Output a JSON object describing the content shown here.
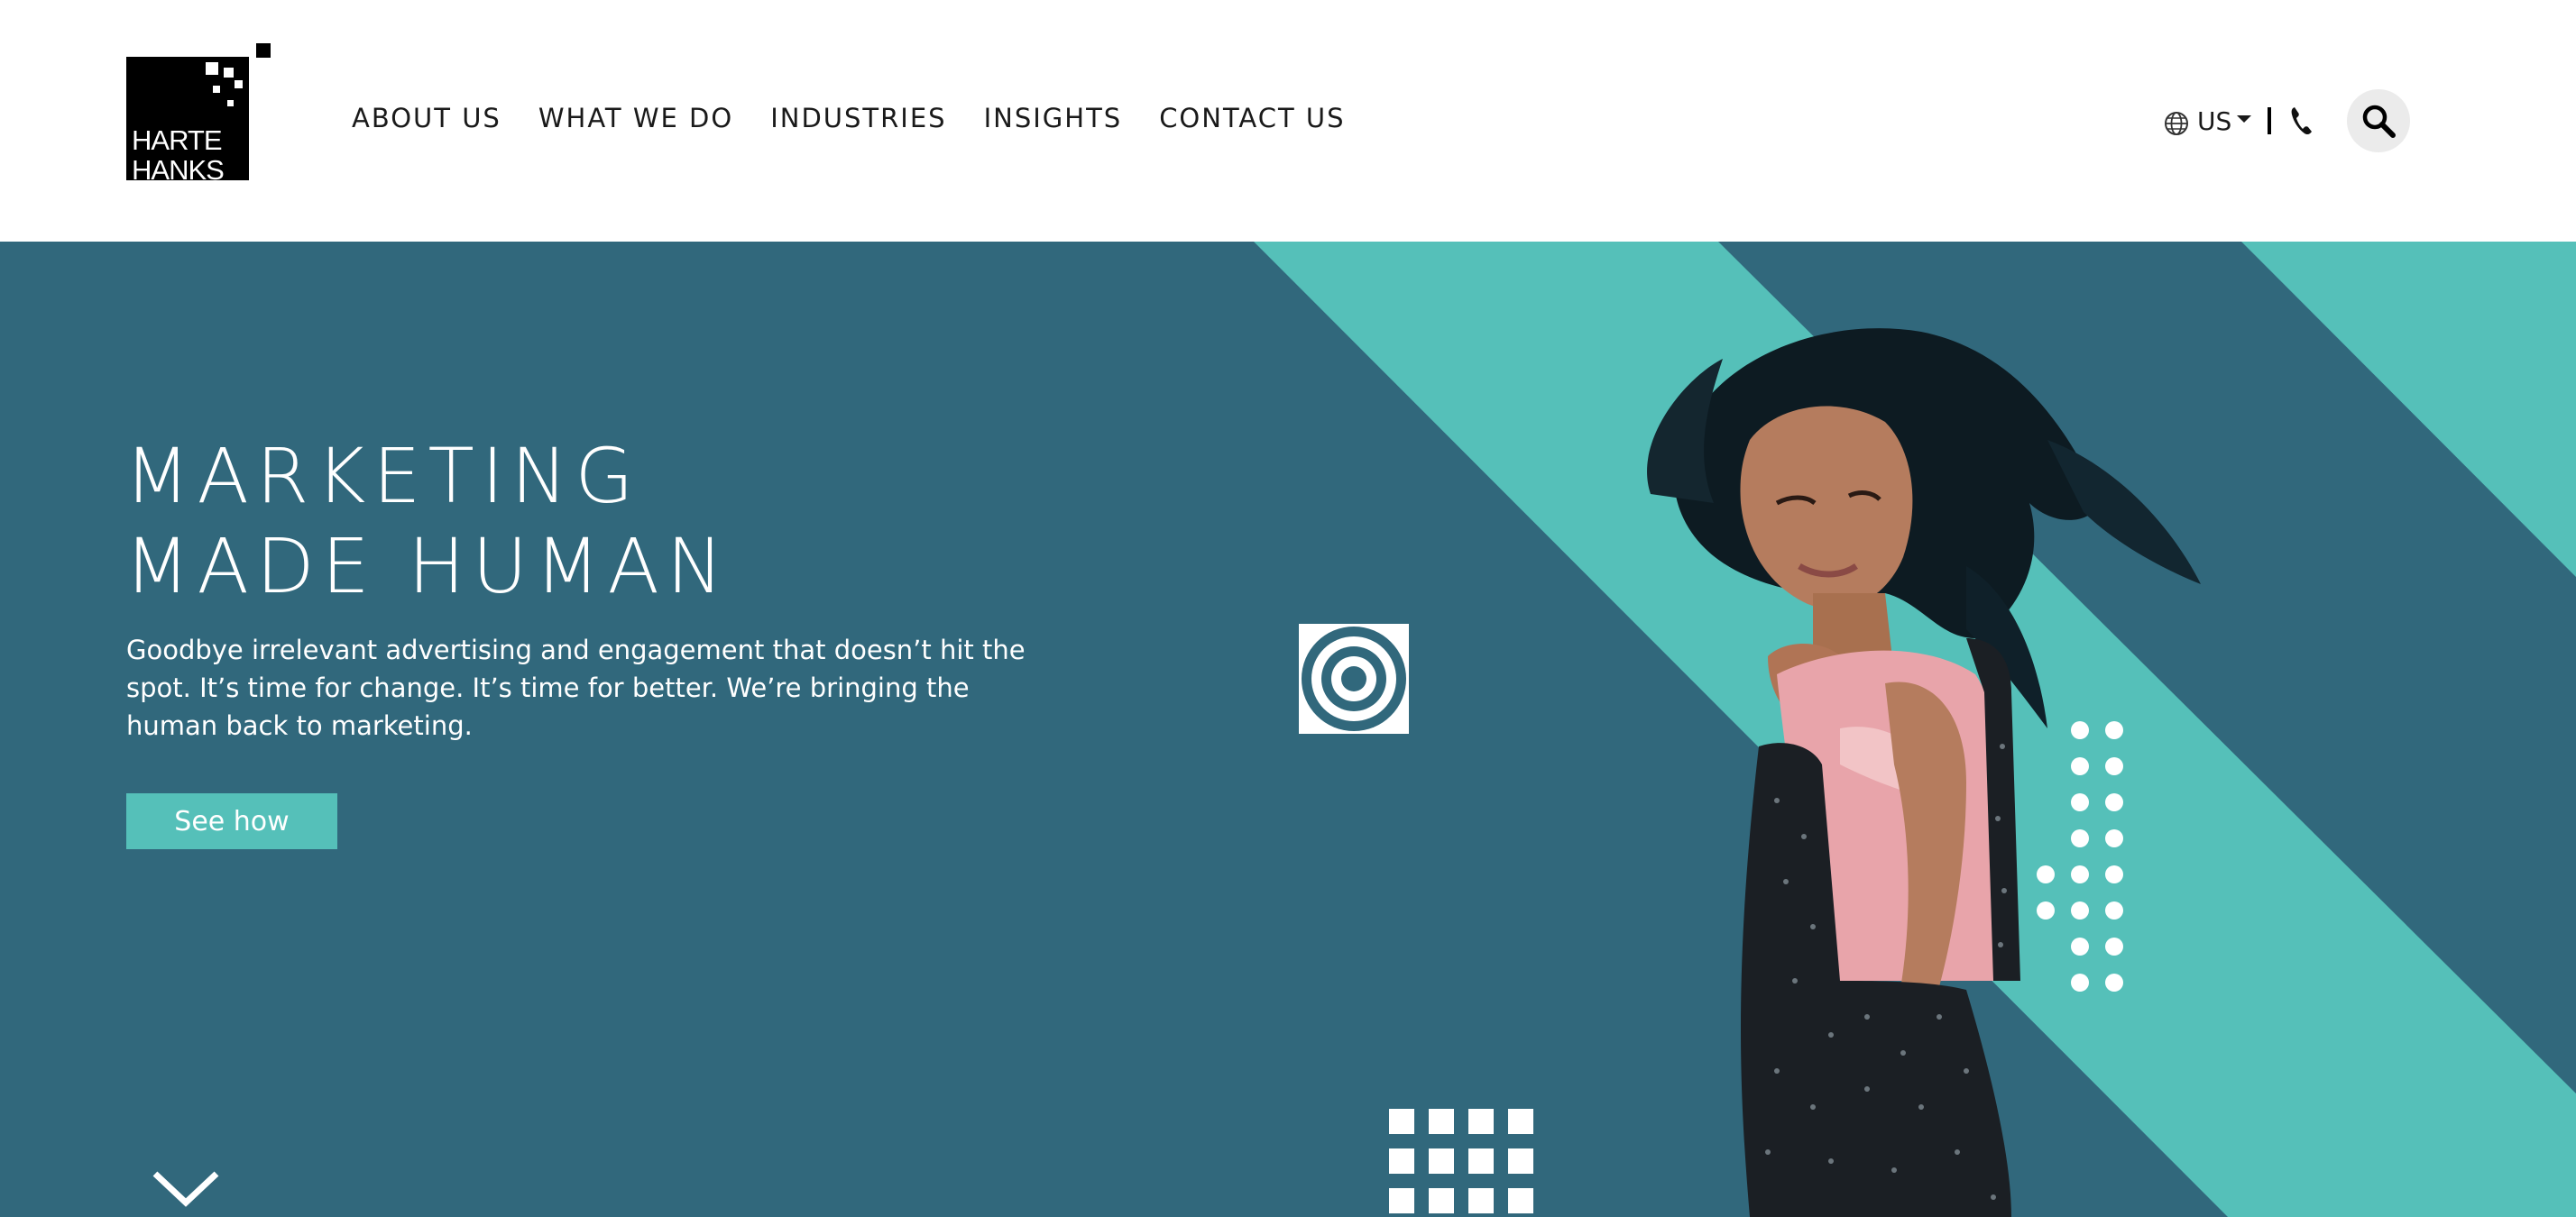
{
  "logo": {
    "line1": "HARTE",
    "line2": "HANKS"
  },
  "nav": {
    "items": [
      {
        "label": "ABOUT US"
      },
      {
        "label": "WHAT WE DO"
      },
      {
        "label": "INDUSTRIES"
      },
      {
        "label": "INSIGHTS"
      },
      {
        "label": "CONTACT US"
      }
    ]
  },
  "utility": {
    "locale": "US",
    "icons": [
      "globe-icon",
      "caret-down-icon",
      "phone-icon",
      "search-icon"
    ]
  },
  "hero": {
    "title_line1": "MARKETING",
    "title_line2": "MADE HUMAN",
    "description": "Goodbye irrelevant advertising and engagement that doesn’t hit the spot. It’s time for change. It’s time for better. We’re bringing the human back to marketing.",
    "cta_label": "See how"
  },
  "colors": {
    "hero_background": "#31687c",
    "accent_teal": "#55c0b9",
    "nav_text": "#1a1a1a",
    "search_button_bg": "#ebebeb"
  }
}
